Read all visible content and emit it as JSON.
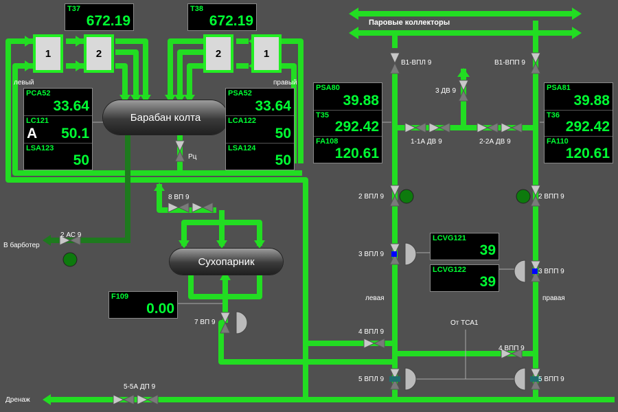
{
  "colors": {
    "pipe": "#22dd22",
    "pipe_dark": "#1e7a1e",
    "value": "#00ff33",
    "background": "#505050"
  },
  "vessels": {
    "drum": "Барабан колта",
    "separator": "Сухопарник"
  },
  "header": {
    "steam_collectors": "Паровые коллекторы"
  },
  "burners": {
    "l1": "1",
    "l2": "2",
    "r2": "2",
    "r1": "1"
  },
  "panels": {
    "t37": {
      "tag": "T37",
      "value": "672.19"
    },
    "t38": {
      "tag": "T38",
      "value": "672.19"
    },
    "drum_left": [
      {
        "tag": "PCA52",
        "value": "33.64"
      },
      {
        "tag": "LC121",
        "mode": "A",
        "value": "50.1"
      },
      {
        "tag": "LSA123",
        "value": "50"
      }
    ],
    "drum_right": [
      {
        "tag": "PSA52",
        "value": "33.64"
      },
      {
        "tag": "LCA122",
        "value": "50"
      },
      {
        "tag": "LSA124",
        "value": "50"
      }
    ],
    "left_steam": [
      {
        "tag": "PSA80",
        "value": "39.88"
      },
      {
        "tag": "T35",
        "value": "292.42"
      },
      {
        "tag": "FA108",
        "value": "120.61"
      }
    ],
    "right_steam": [
      {
        "tag": "PSA81",
        "value": "39.88"
      },
      {
        "tag": "T36",
        "value": "292.42"
      },
      {
        "tag": "FA110",
        "value": "120.61"
      }
    ],
    "lcvg121": {
      "tag": "LCVG121",
      "value": "39"
    },
    "lcvg122": {
      "tag": "LCVG122",
      "value": "39"
    },
    "f109": {
      "tag": "F109",
      "value": "0.00"
    }
  },
  "labels": {
    "left": "левый",
    "right": "правый",
    "rc": "Рц",
    "vp8": "8 ВП 9",
    "ac2": "2 АС 9",
    "to_bubbler": "В барботер",
    "vp7": "7 ВП 9",
    "dp55a": "5-5А ДП 9",
    "drain": "Дренаж",
    "b1vpl": "В1-ВПЛ 9",
    "b1vpp": "В1-ВПП 9",
    "dv3": "3 ДВ 9",
    "dv11a": "1-1А ДВ 9",
    "dv22a": "2-2А ДВ 9",
    "vpl2": "2 ВПЛ 9",
    "vpp2": "2 ВПП 9",
    "vpl3": "3 ВПЛ 9",
    "vpp3": "3 ВПП 9",
    "left_line": "левая",
    "right_line": "правая",
    "from_tca1": "От ТСА1",
    "vpl4": "4 ВПЛ 9",
    "vpp4": "4 ВПП 9",
    "vpl5": "5 ВПЛ 9",
    "vpp5": "5 ВПП 9"
  }
}
